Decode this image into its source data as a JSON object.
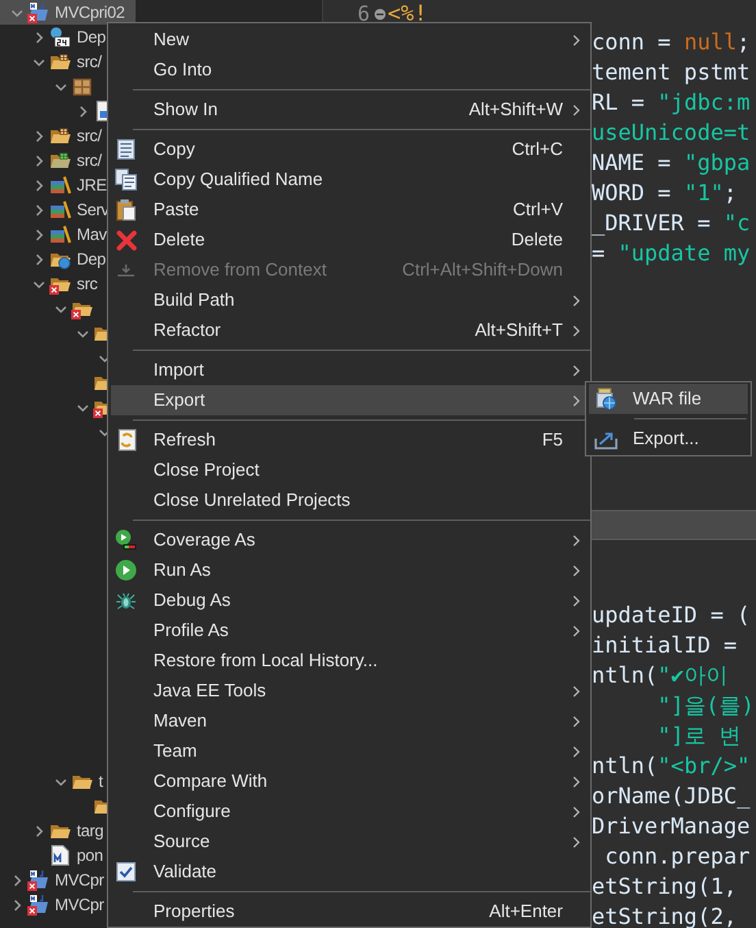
{
  "tree": [
    {
      "label": "MVCpri02",
      "kind": "project",
      "expanded": true,
      "selected": true,
      "error": true,
      "children": [
        {
          "label": "Dep",
          "kind": "descriptor",
          "expanded": false,
          "selected": false,
          "error": false
        },
        {
          "label": "src/",
          "kind": "package_folder",
          "expanded": true,
          "selected": false,
          "error": false,
          "children": [
            {
              "kind": "package",
              "expanded": true,
              "selected": false,
              "error": false,
              "children": [
                {
                  "kind": "jsp_file",
                  "expanded": false,
                  "selected": false,
                  "error": false
                }
              ]
            }
          ]
        },
        {
          "label": "src/",
          "kind": "package_folder",
          "expanded": false,
          "selected": false,
          "error": false
        },
        {
          "label": "src/",
          "kind": "test_folder",
          "expanded": false,
          "selected": false,
          "error": false
        },
        {
          "label": "JRE",
          "kind": "library",
          "expanded": false,
          "selected": false,
          "error": false
        },
        {
          "label": "Serv",
          "kind": "library",
          "expanded": false,
          "selected": false,
          "error": false
        },
        {
          "label": "Mav",
          "kind": "library",
          "expanded": false,
          "selected": false,
          "error": false
        },
        {
          "label": "Dep",
          "kind": "deployed",
          "expanded": false,
          "selected": false,
          "error": false
        },
        {
          "label": "src",
          "kind": "folder",
          "expanded": true,
          "selected": false,
          "error": true,
          "children": [
            {
              "kind": "folder",
              "expanded": true,
              "selected": false,
              "error": true,
              "children": [
                {
                  "kind": "folder",
                  "expanded": true,
                  "selected": false,
                  "error": false,
                  "children": [
                    {
                      "expanded": true,
                      "selected": false
                    }
                  ]
                },
                {
                  "kind": "folder",
                  "selected": false,
                  "error": false
                },
                {
                  "kind": "folder",
                  "expanded": true,
                  "selected": false,
                  "error": true,
                  "children": [
                    {
                      "expanded": true,
                      "selected": false
                    }
                  ]
                }
              ]
            },
            {
              "label": "t",
              "kind": "folder",
              "expanded": true,
              "selected": false,
              "error": false,
              "children": [
                {
                  "kind": "folder",
                  "selected": false,
                  "error": false
                }
              ]
            }
          ]
        },
        {
          "label": "targ",
          "kind": "folder",
          "expanded": false,
          "selected": false,
          "error": false
        },
        {
          "label": "pon",
          "kind": "pom",
          "selected": false,
          "error": false
        }
      ]
    },
    {
      "label": "MVCpr",
      "kind": "project",
      "expanded": false,
      "selected": false,
      "error": true
    },
    {
      "label": "MVCpr",
      "kind": "project",
      "expanded": false,
      "selected": false,
      "error": true
    }
  ],
  "editor": {
    "lines": [
      {
        "kind": "code",
        "number": "6",
        "fold_marker": true,
        "current": false,
        "segments": [
          {
            "text": "<%!",
            "kind": "jsp"
          }
        ]
      },
      {
        "kind": "code",
        "current": false,
        "segments": [
          {
            "text": "conn = ",
            "kind": "plain"
          },
          {
            "text": "null",
            "kind": "keyword"
          },
          {
            "text": ";",
            "kind": "plain"
          }
        ]
      },
      {
        "kind": "code",
        "current": false,
        "segments": [
          {
            "text": "tement pstmt",
            "kind": "plain"
          }
        ]
      },
      {
        "kind": "code",
        "current": false,
        "segments": [
          {
            "text": "RL = ",
            "kind": "plain"
          },
          {
            "text": "\"jdbc:m",
            "kind": "string"
          }
        ]
      },
      {
        "kind": "code",
        "current": false,
        "segments": [
          {
            "text": "useUnicode=t",
            "kind": "string"
          }
        ]
      },
      {
        "kind": "code",
        "current": false,
        "segments": [
          {
            "text": "NAME = ",
            "kind": "plain"
          },
          {
            "text": "\"gbpa",
            "kind": "string"
          }
        ]
      },
      {
        "kind": "code",
        "current": false,
        "segments": [
          {
            "text": "WORD = ",
            "kind": "plain"
          },
          {
            "text": "\"1\"",
            "kind": "string"
          },
          {
            "text": ";",
            "kind": "plain"
          }
        ]
      },
      {
        "kind": "code",
        "current": false,
        "segments": [
          {
            "text": "_DRIVER = ",
            "kind": "plain"
          },
          {
            "text": "\"c",
            "kind": "string"
          }
        ]
      },
      {
        "kind": "code",
        "current": false,
        "segments": [
          {
            "text": "= ",
            "kind": "plain"
          },
          {
            "text": "\"update my",
            "kind": "string"
          }
        ]
      },
      {
        "kind": "blank",
        "current": false
      },
      {
        "kind": "blank",
        "current": false
      },
      {
        "kind": "blank",
        "current": false
      },
      {
        "kind": "blank",
        "current": false
      },
      {
        "kind": "blank",
        "current": false
      },
      {
        "kind": "blank",
        "current": false
      },
      {
        "kind": "blank",
        "current": false
      },
      {
        "kind": "blank",
        "current": false
      },
      {
        "kind": "blank",
        "current": true
      },
      {
        "kind": "blank",
        "current": false
      },
      {
        "kind": "blank",
        "current": false
      },
      {
        "kind": "code",
        "current": false,
        "segments": [
          {
            "text": "updateID = (",
            "kind": "plain"
          }
        ]
      },
      {
        "kind": "code",
        "current": false,
        "segments": [
          {
            "text": "initialID = ",
            "kind": "plain"
          }
        ]
      },
      {
        "kind": "code",
        "current": false,
        "segments": [
          {
            "text": "ntln(",
            "kind": "plain"
          },
          {
            "text": "\"✔아이",
            "kind": "string"
          }
        ]
      },
      {
        "kind": "code",
        "current": false,
        "segments": [
          {
            "text": "     \"]을(를)",
            "kind": "string"
          }
        ]
      },
      {
        "kind": "code",
        "current": false,
        "segments": [
          {
            "text": "     \"]로 변",
            "kind": "string"
          }
        ]
      },
      {
        "kind": "code",
        "current": false,
        "segments": [
          {
            "text": "ntln(",
            "kind": "plain"
          },
          {
            "text": "\"<br/>\"",
            "kind": "string"
          }
        ]
      },
      {
        "kind": "code",
        "current": false,
        "segments": [
          {
            "text": "orName(JDBC_",
            "kind": "plain"
          }
        ]
      },
      {
        "kind": "code",
        "current": false,
        "segments": [
          {
            "text": "DriverManage",
            "kind": "plain"
          }
        ]
      },
      {
        "kind": "code",
        "current": false,
        "segments": [
          {
            "text": " conn.prepar",
            "kind": "plain"
          }
        ]
      },
      {
        "kind": "code",
        "current": false,
        "segments": [
          {
            "text": "etString(1,",
            "kind": "plain"
          }
        ]
      },
      {
        "kind": "code",
        "current": false,
        "segments": [
          {
            "text": "etString(2,",
            "kind": "plain"
          }
        ]
      }
    ]
  },
  "context_menu": {
    "items": [
      {
        "kind": "item",
        "label": "New",
        "submenu": true,
        "selected": false,
        "disabled": false
      },
      {
        "kind": "item",
        "label": "Go Into",
        "submenu": false,
        "selected": false,
        "disabled": false
      },
      {
        "kind": "separator"
      },
      {
        "kind": "item",
        "label": "Show In",
        "shortcut": "Alt+Shift+W",
        "submenu": true,
        "selected": false,
        "disabled": false
      },
      {
        "kind": "separator"
      },
      {
        "kind": "item",
        "label": "Copy",
        "shortcut": "Ctrl+C",
        "submenu": false,
        "selected": false,
        "disabled": false
      },
      {
        "kind": "item",
        "label": "Copy Qualified Name",
        "submenu": false,
        "selected": false,
        "disabled": false
      },
      {
        "kind": "item",
        "label": "Paste",
        "shortcut": "Ctrl+V",
        "submenu": false,
        "selected": false,
        "disabled": false
      },
      {
        "kind": "item",
        "label": "Delete",
        "shortcut": "Delete",
        "submenu": false,
        "selected": false,
        "disabled": false
      },
      {
        "kind": "item",
        "label": "Remove from Context",
        "shortcut": "Ctrl+Alt+Shift+Down",
        "submenu": false,
        "selected": false,
        "disabled": true
      },
      {
        "kind": "item",
        "label": "Build Path",
        "submenu": true,
        "selected": false,
        "disabled": false
      },
      {
        "kind": "item",
        "label": "Refactor",
        "shortcut": "Alt+Shift+T",
        "submenu": true,
        "selected": false,
        "disabled": false
      },
      {
        "kind": "separator"
      },
      {
        "kind": "item",
        "label": "Import",
        "submenu": true,
        "selected": false,
        "disabled": false
      },
      {
        "kind": "item",
        "label": "Export",
        "submenu": true,
        "selected": true,
        "disabled": false
      },
      {
        "kind": "separator"
      },
      {
        "kind": "item",
        "label": "Refresh",
        "shortcut": "F5",
        "submenu": false,
        "selected": false,
        "disabled": false
      },
      {
        "kind": "item",
        "label": "Close Project",
        "submenu": false,
        "selected": false,
        "disabled": false
      },
      {
        "kind": "item",
        "label": "Close Unrelated Projects",
        "submenu": false,
        "selected": false,
        "disabled": false
      },
      {
        "kind": "separator"
      },
      {
        "kind": "item",
        "label": "Coverage As",
        "submenu": true,
        "selected": false,
        "disabled": false
      },
      {
        "kind": "item",
        "label": "Run As",
        "submenu": true,
        "selected": false,
        "disabled": false
      },
      {
        "kind": "item",
        "label": "Debug As",
        "submenu": true,
        "selected": false,
        "disabled": false
      },
      {
        "kind": "item",
        "label": "Profile As",
        "submenu": true,
        "selected": false,
        "disabled": false
      },
      {
        "kind": "item",
        "label": "Restore from Local History...",
        "submenu": false,
        "selected": false,
        "disabled": false
      },
      {
        "kind": "item",
        "label": "Java EE Tools",
        "submenu": true,
        "selected": false,
        "disabled": false
      },
      {
        "kind": "item",
        "label": "Maven",
        "submenu": true,
        "selected": false,
        "disabled": false
      },
      {
        "kind": "item",
        "label": "Team",
        "submenu": true,
        "selected": false,
        "disabled": false
      },
      {
        "kind": "item",
        "label": "Compare With",
        "submenu": true,
        "selected": false,
        "disabled": false
      },
      {
        "kind": "item",
        "label": "Configure",
        "submenu": true,
        "selected": false,
        "disabled": false
      },
      {
        "kind": "item",
        "label": "Source",
        "submenu": true,
        "selected": false,
        "disabled": false
      },
      {
        "kind": "check",
        "label": "Validate",
        "checked": true,
        "submenu": false,
        "selected": false,
        "disabled": false
      },
      {
        "kind": "separator"
      },
      {
        "kind": "item",
        "label": "Properties",
        "shortcut": "Alt+Enter",
        "submenu": false,
        "selected": false,
        "disabled": false
      }
    ]
  },
  "export_submenu": {
    "items": [
      {
        "kind": "item",
        "label": "WAR file",
        "selected": true
      },
      {
        "kind": "separator"
      },
      {
        "kind": "item",
        "label": "Export...",
        "selected": false
      }
    ]
  }
}
